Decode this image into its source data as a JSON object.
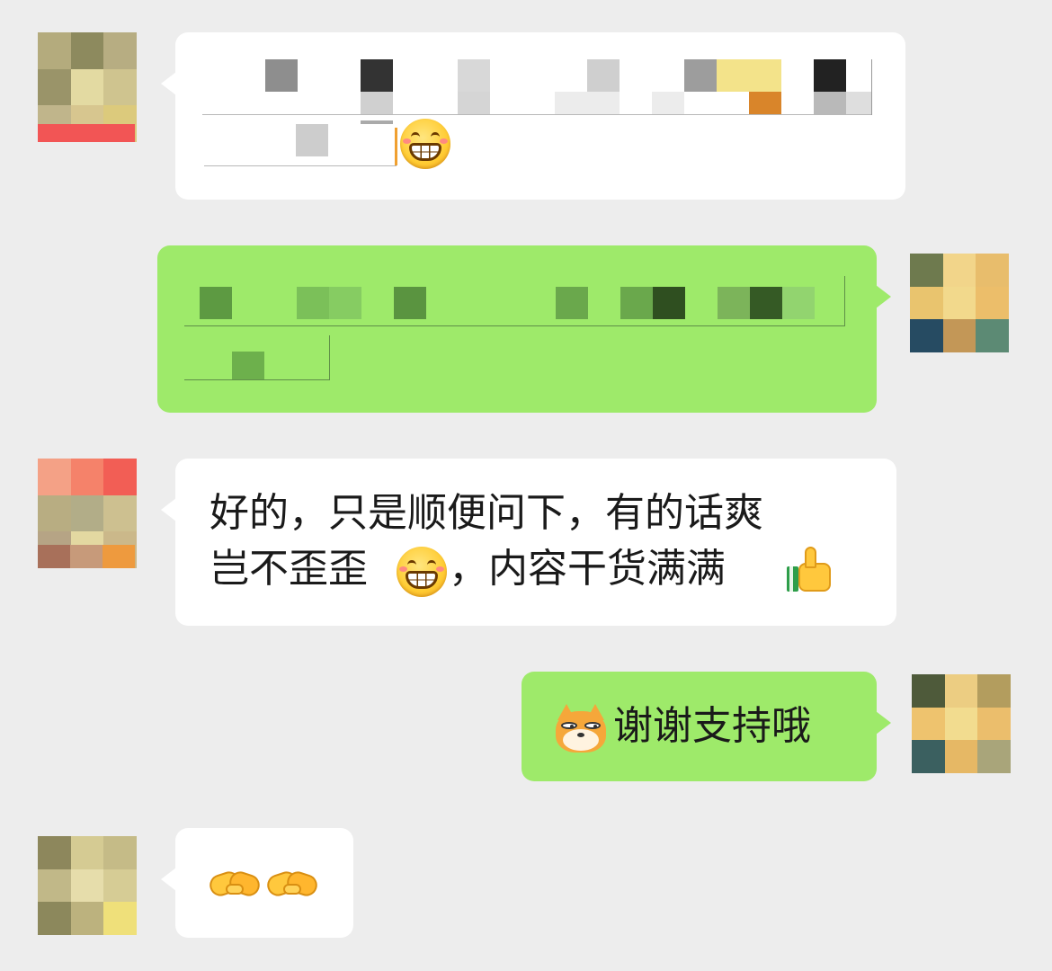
{
  "messages": [
    {
      "sender": "other",
      "blurred": true
    },
    {
      "sender": "self",
      "blurred": true
    },
    {
      "sender": "other",
      "line1": "好的，只是顺便问下，有的话爽",
      "line2": "岂不歪歪",
      "line2b": "，内容干货满满",
      "emoji_mid": "grin-icon",
      "emoji_end": "thumbs-up-icon"
    },
    {
      "sender": "self",
      "text": "谢谢支持哦",
      "emoji_start": "doge-cat-icon"
    },
    {
      "sender": "other",
      "emojis": [
        "handshake-icon",
        "handshake-icon"
      ]
    }
  ],
  "colors": {
    "background": "#ededed",
    "bubble_other": "#ffffff",
    "bubble_self": "#9eea6a"
  }
}
